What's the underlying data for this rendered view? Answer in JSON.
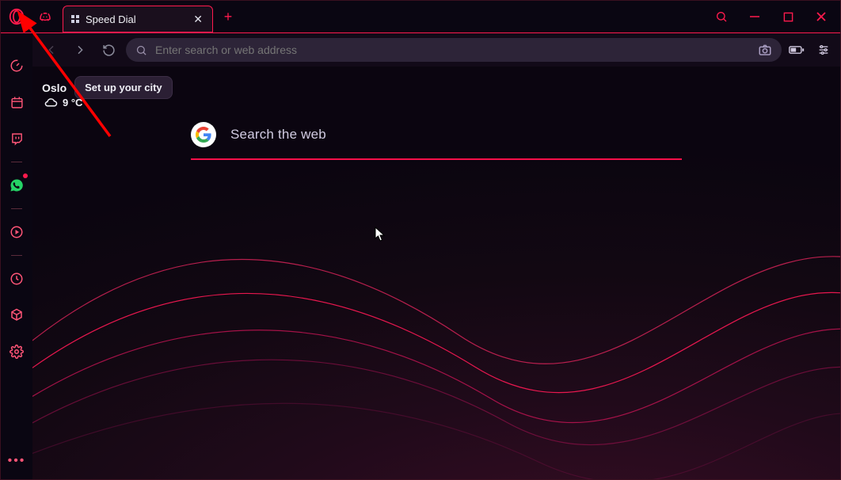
{
  "colors": {
    "accent": "#ff1a4d",
    "bg": "#0a0612"
  },
  "titlebar": {
    "tab_title": "Speed Dial"
  },
  "address": {
    "placeholder": "Enter search or web address"
  },
  "weather": {
    "city": "Oslo",
    "setup_label": "Set up your city",
    "temp": "9 °C"
  },
  "search": {
    "placeholder": "Search the web"
  },
  "sidebar": {
    "items": [
      {
        "name": "limiter-icon"
      },
      {
        "name": "calendar-icon"
      },
      {
        "name": "twitch-icon"
      },
      {
        "name": "whatsapp-icon"
      },
      {
        "name": "player-icon"
      },
      {
        "name": "history-icon"
      },
      {
        "name": "mods-icon"
      },
      {
        "name": "settings-icon"
      }
    ]
  }
}
